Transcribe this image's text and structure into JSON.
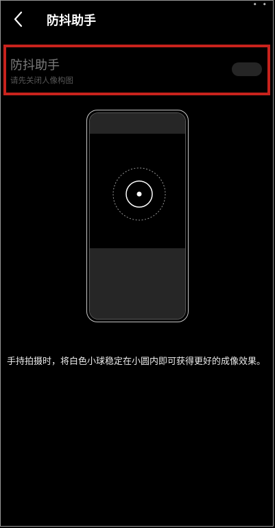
{
  "header": {
    "title": "防抖助手"
  },
  "setting": {
    "title": "防抖助手",
    "subtitle": "请先关闭人像构图",
    "enabled": false
  },
  "description": "手持拍摄时，将白色小球稳定在小圆内即可获得更好的成像效果。",
  "colors": {
    "highlight_border": "#c8221d",
    "background": "#000000"
  }
}
